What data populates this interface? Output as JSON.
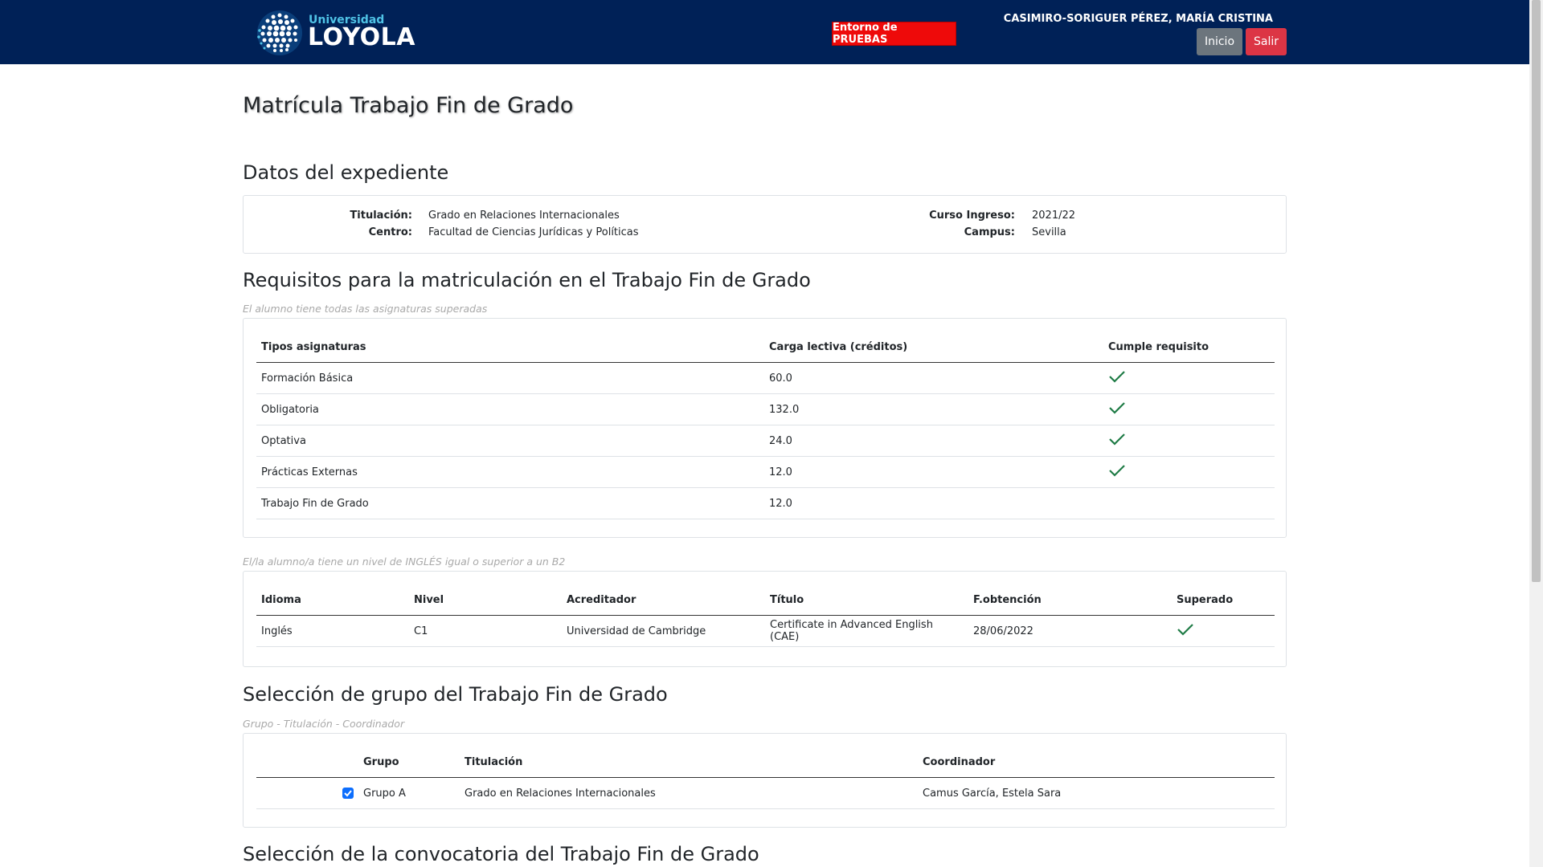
{
  "header": {
    "logo_small": "Universidad",
    "logo_big": "LOYOLA",
    "environment_badge": "Entorno de PRUEBAS",
    "user_name": "CASIMIRO-SORIGUER PÉREZ, MARÍA CRISTINA",
    "inicio_label": "Inicio",
    "salir_label": "Salir"
  },
  "page": {
    "title": "Matrícula Trabajo Fin de Grado"
  },
  "expediente": {
    "title": "Datos del expediente",
    "titulacion_label": "Titulación:",
    "titulacion_value": "Grado en Relaciones Internacionales",
    "centro_label": "Centro:",
    "centro_value": "Facultad de Ciencias Jurídicas y Políticas",
    "curso_label": "Curso Ingreso:",
    "curso_value": "2021/22",
    "campus_label": "Campus:",
    "campus_value": "Sevilla"
  },
  "requisitos": {
    "title": "Requisitos para la matriculación en el Trabajo Fin de Grado",
    "note": "El alumno tiene todas las asignaturas superadas",
    "headers": [
      "Tipos asignaturas",
      "Carga lectiva (créditos)",
      "Cumple requisito"
    ],
    "rows": [
      {
        "tipo": "Formación Básica",
        "carga": "60.0",
        "cumple": true
      },
      {
        "tipo": "Obligatoria",
        "carga": "132.0",
        "cumple": true
      },
      {
        "tipo": "Optativa",
        "carga": "24.0",
        "cumple": true
      },
      {
        "tipo": "Prácticas Externas",
        "carga": "12.0",
        "cumple": true
      },
      {
        "tipo": "Trabajo Fin de Grado",
        "carga": "12.0",
        "cumple": false
      }
    ]
  },
  "idioma": {
    "note": "El/la alumno/a tiene un nivel de INGLÉS igual o superior a un B2",
    "headers": [
      "Idioma",
      "Nivel",
      "Acreditador",
      "Título",
      "F.obtención",
      "Superado"
    ],
    "rows": [
      {
        "idioma": "Inglés",
        "nivel": "C1",
        "acreditador": "Universidad de Cambridge",
        "titulo": "Certificate in Advanced English (CAE)",
        "fecha": "28/06/2022",
        "superado": true
      }
    ]
  },
  "grupo": {
    "title": "Selección de grupo del Trabajo Fin de Grado",
    "note": "Grupo - Titulación - Coordinador",
    "headers": [
      "",
      "Grupo",
      "Titulación",
      "Coordinador"
    ],
    "rows": [
      {
        "checked": true,
        "grupo": "Grupo A",
        "titulacion": "Grado en Relaciones Internacionales",
        "coordinador": "Camus García, Estela Sara"
      }
    ]
  },
  "convocatoria": {
    "title": "Selección de la convocatoria del Trabajo Fin de Grado"
  },
  "colors": {
    "header_bg": "#002157",
    "badge_red": "#ee0a0a",
    "btn_gray": "#6c757d",
    "btn_red": "#dc3545",
    "check_green": "#1e7b45",
    "checkbox_blue": "#0d6efd"
  }
}
